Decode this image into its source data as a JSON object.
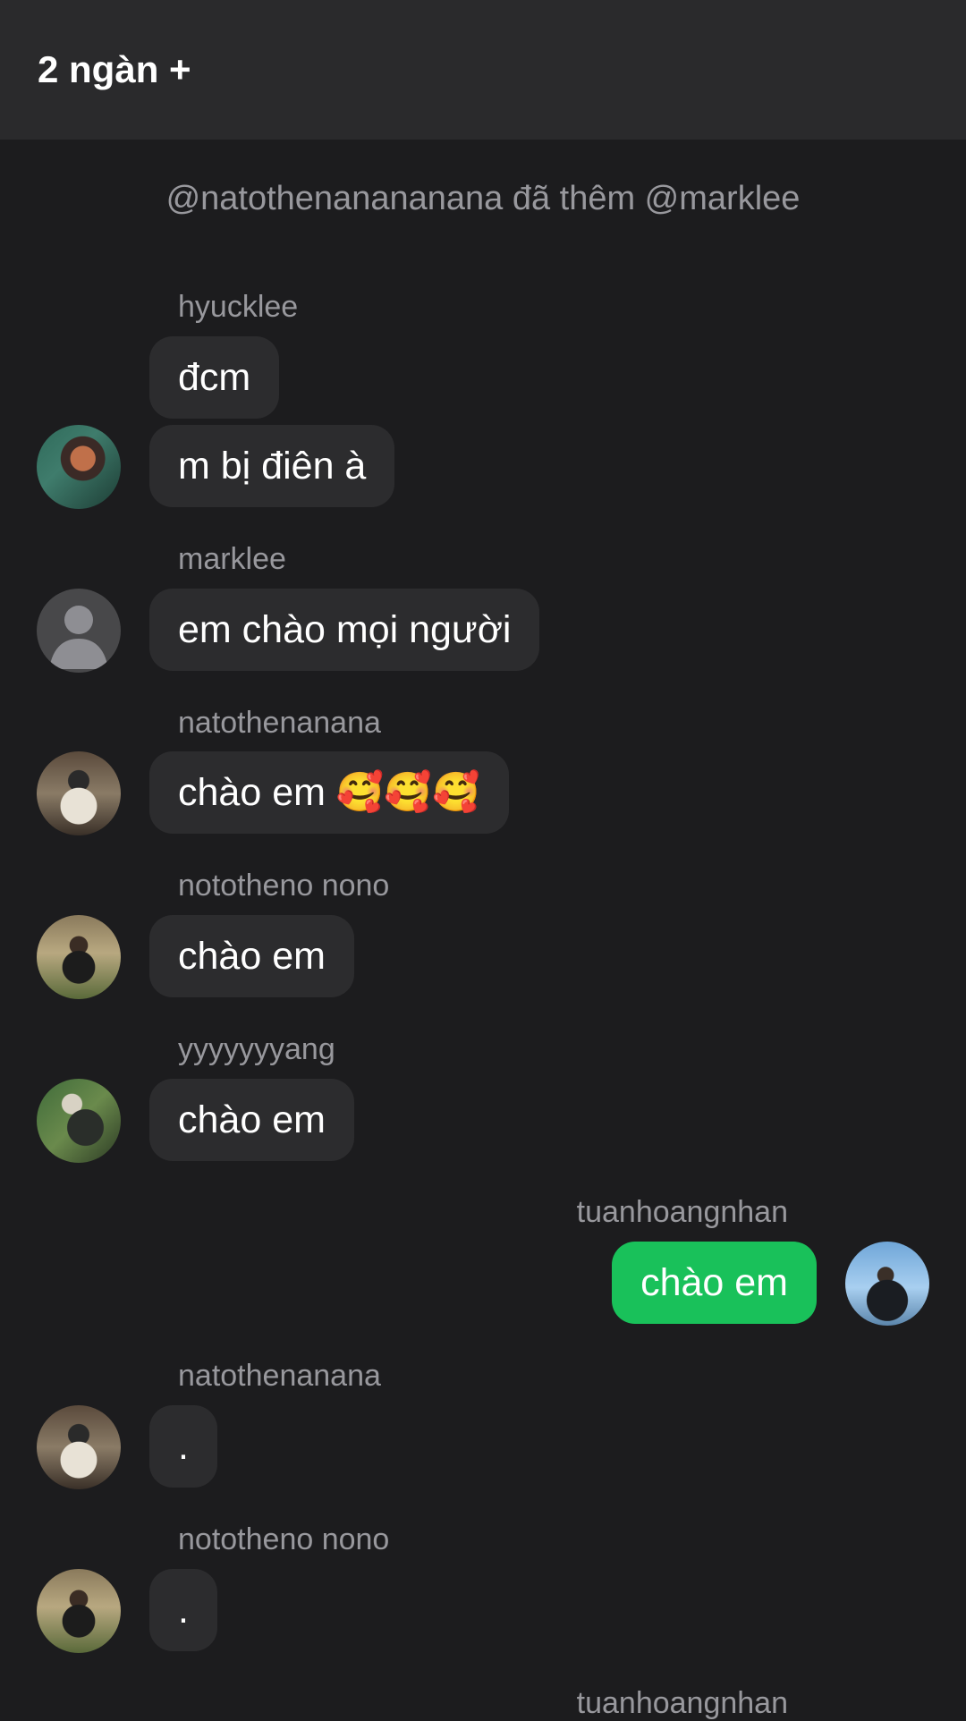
{
  "header": {
    "title": "2 ngàn +"
  },
  "system_message": "@natothenanananana đã thêm @marklee",
  "messages": [
    {
      "sender": "hyucklee",
      "avatar": "profile-photo",
      "bubbles": [
        "đcm",
        "m bị điên à"
      ]
    },
    {
      "sender": "marklee",
      "avatar": "default-avatar-icon",
      "bubbles": [
        "em chào mọi người"
      ]
    },
    {
      "sender": "natothenanana",
      "avatar": "profile-photo",
      "bubbles": [
        "chào em 🥰🥰🥰"
      ]
    },
    {
      "sender": "nototheno nono",
      "avatar": "profile-photo",
      "bubbles": [
        "chào em"
      ]
    },
    {
      "sender": "yyyyyyyang",
      "avatar": "profile-photo",
      "bubbles": [
        "chào em"
      ]
    },
    {
      "sender": "tuanhoangnhan",
      "avatar": "profile-photo",
      "outgoing": true,
      "bubbles": [
        "chào em"
      ]
    },
    {
      "sender": "natothenanana",
      "avatar": "profile-photo",
      "bubbles": [
        "."
      ]
    },
    {
      "sender": "nototheno nono",
      "avatar": "profile-photo",
      "bubbles": [
        "."
      ]
    },
    {
      "sender": "tuanhoangnhan",
      "avatar": "profile-photo",
      "outgoing": true,
      "bubbles": []
    }
  ],
  "colors": {
    "background": "#1c1c1e",
    "header_bg": "#2a2a2c",
    "bubble_incoming": "#2c2c2e",
    "bubble_outgoing": "#19c15a",
    "secondary_text": "#98989d"
  }
}
